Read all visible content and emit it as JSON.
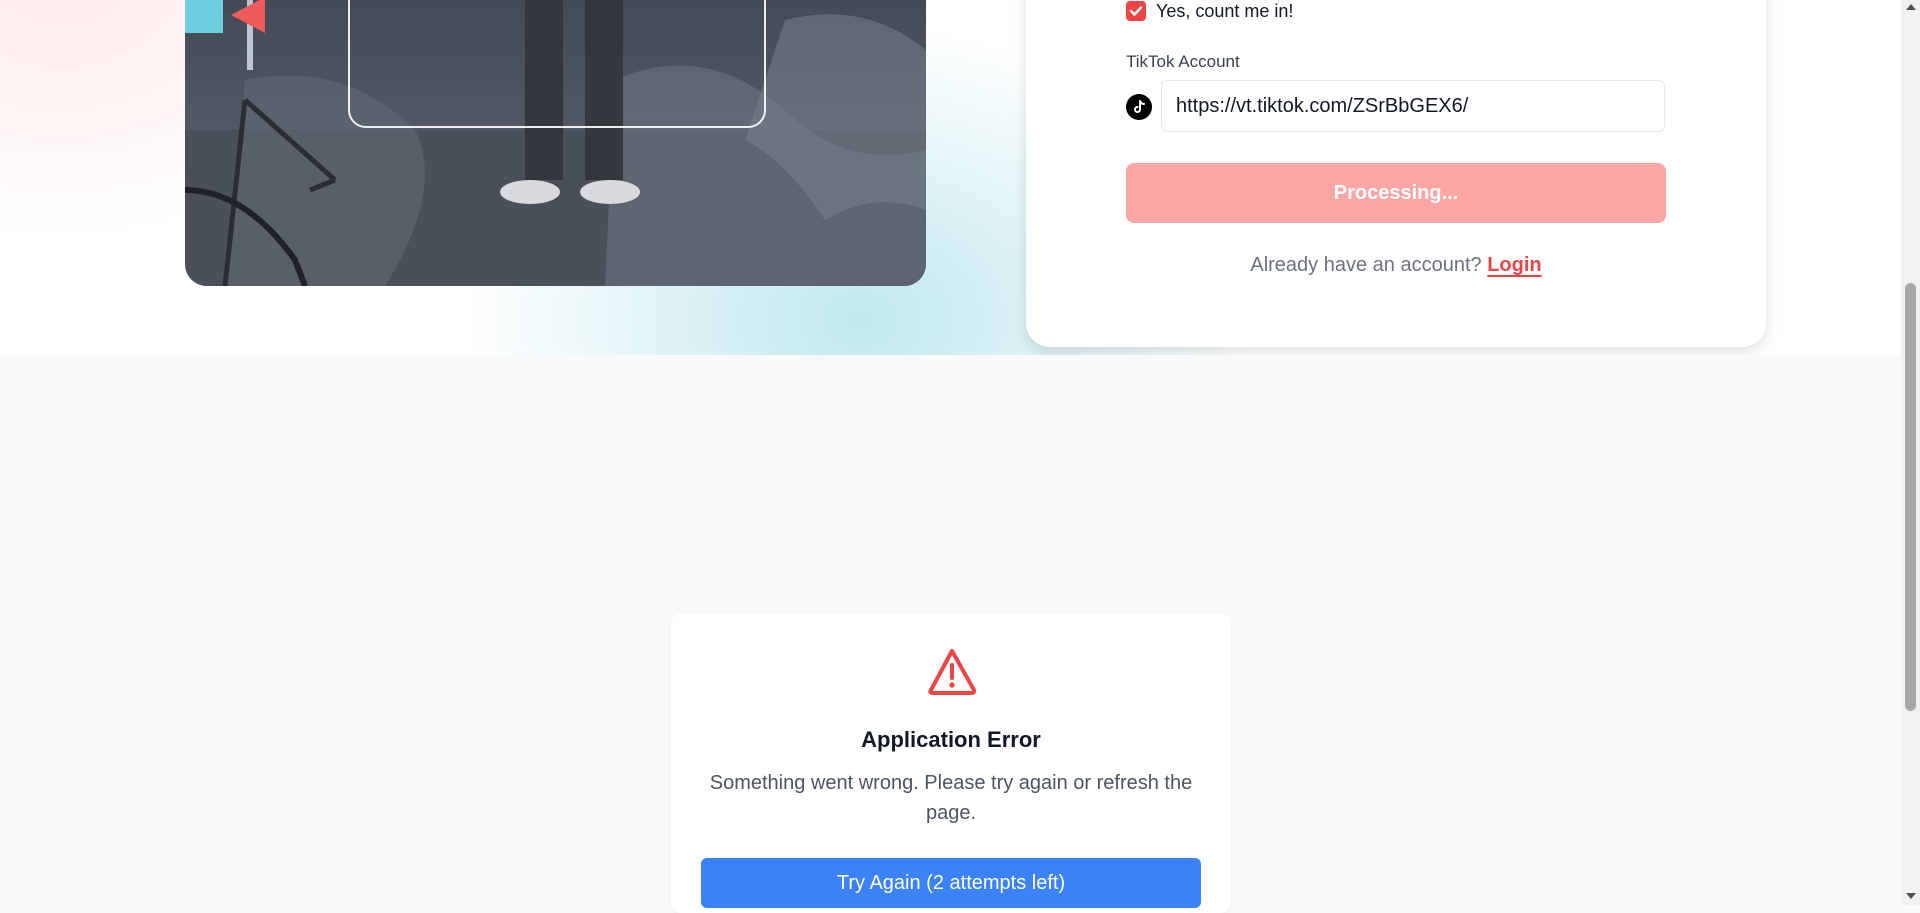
{
  "signup": {
    "consent_label": "Yes, count me in!",
    "consent_checked": true,
    "tiktok_label": "TikTok Account",
    "tiktok_url": "https://vt.tiktok.com/ZSrBbGEX6/",
    "processing_label": "Processing...",
    "login_prompt": "Already have an account?",
    "login_link": "Login"
  },
  "error": {
    "title": "Application Error",
    "message": "Something went wrong. Please try again or refresh the page.",
    "retry_label": "Try Again (2 attempts left)"
  },
  "colors": {
    "brand_red": "#ef4444",
    "processing_bg": "#fca5a5",
    "primary_blue": "#3b82f6",
    "shape_cyan": "#6ecfe3"
  },
  "icons": [
    "checkbox-checked-icon",
    "tiktok-icon",
    "warning-triangle-icon"
  ]
}
